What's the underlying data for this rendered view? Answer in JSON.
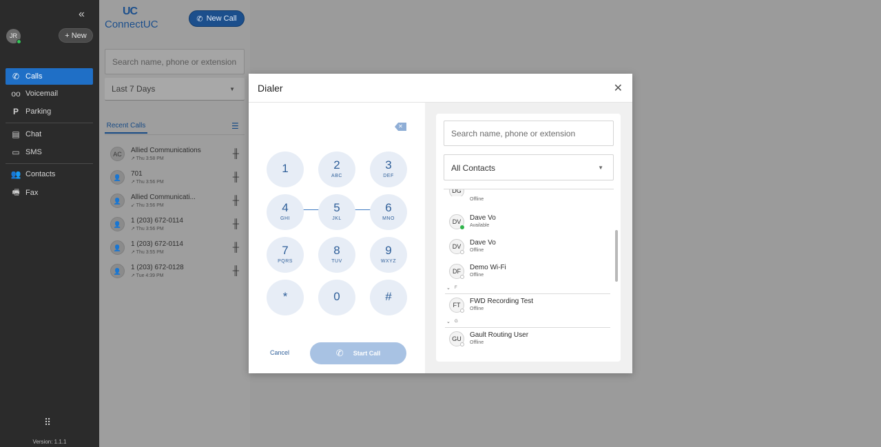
{
  "nav": {
    "collapse_icon": "double-chevron-left-icon",
    "user_initials": "JR",
    "new_label": "New",
    "items": [
      {
        "label": "Calls",
        "icon": "phone-icon",
        "active": true
      },
      {
        "label": "Voicemail",
        "icon": "voicemail-icon"
      },
      {
        "label": "Parking",
        "icon": "parking-icon"
      },
      {
        "label": "Chat",
        "icon": "chat-icon"
      },
      {
        "label": "SMS",
        "icon": "sms-icon"
      },
      {
        "label": "Contacts",
        "icon": "contacts-icon"
      },
      {
        "label": "Fax",
        "icon": "fax-icon"
      }
    ],
    "version": "Version: 1.1.1"
  },
  "brand": {
    "logo_mark": "UC",
    "name": "ConnectUC"
  },
  "header": {
    "new_call_label": "New Call"
  },
  "recent": {
    "search_placeholder": "Search name, phone or extension",
    "range": "Last 7 Days",
    "tab_label": "Recent Calls",
    "calls": [
      {
        "initials": "AC",
        "name": "Allied Communications",
        "time": "↗ Thu 3:58 PM"
      },
      {
        "initials": "",
        "name": "701",
        "time": "↗ Thu 3:56 PM"
      },
      {
        "initials": "",
        "name": "Allied Communicati...",
        "time": "↙ Thu 3:56 PM"
      },
      {
        "initials": "",
        "name": "1 (203) 672-0114",
        "time": "↗ Thu 3:56 PM"
      },
      {
        "initials": "",
        "name": "1 (203) 672-0114",
        "time": "↗ Thu 3:55 PM"
      },
      {
        "initials": "",
        "name": "1 (203) 672-0128",
        "time": "↗ Tue 4:39 PM"
      }
    ]
  },
  "dialer": {
    "title": "Dialer",
    "keys": [
      {
        "digit": "1",
        "letters": ""
      },
      {
        "digit": "2",
        "letters": "ABC"
      },
      {
        "digit": "3",
        "letters": "DEF"
      },
      {
        "digit": "4",
        "letters": "GHI"
      },
      {
        "digit": "5",
        "letters": "JKL"
      },
      {
        "digit": "6",
        "letters": "MNO"
      },
      {
        "digit": "7",
        "letters": "PQRS"
      },
      {
        "digit": "8",
        "letters": "TUV"
      },
      {
        "digit": "9",
        "letters": "WXYZ"
      },
      {
        "digit": "*",
        "letters": ""
      },
      {
        "digit": "0",
        "letters": ""
      },
      {
        "digit": "#",
        "letters": ""
      }
    ],
    "cancel_label": "Cancel",
    "start_call_label": "Start Call",
    "contacts_search_placeholder": "Search name, phone or extension",
    "contacts_filter": "All Contacts",
    "contacts": [
      {
        "initials": "DG",
        "name": "",
        "status": "Offline"
      },
      {
        "initials": "DV",
        "name": "Dave Vo",
        "status": "Available"
      },
      {
        "initials": "DV",
        "name": "Dave Vo",
        "status": "Offline"
      },
      {
        "initials": "DF",
        "name": "Demo Wi-Fi",
        "status": "Offline"
      },
      {
        "initials": "FT",
        "name": "FWD Recording Test",
        "status": "Offline"
      },
      {
        "initials": "GU",
        "name": "Gault Routing User",
        "status": "Offline"
      }
    ],
    "sections": [
      "F",
      "G"
    ]
  },
  "colors": {
    "accent": "#1f6fc6",
    "brand": "#1c4f8c",
    "available": "#2fb34a"
  }
}
